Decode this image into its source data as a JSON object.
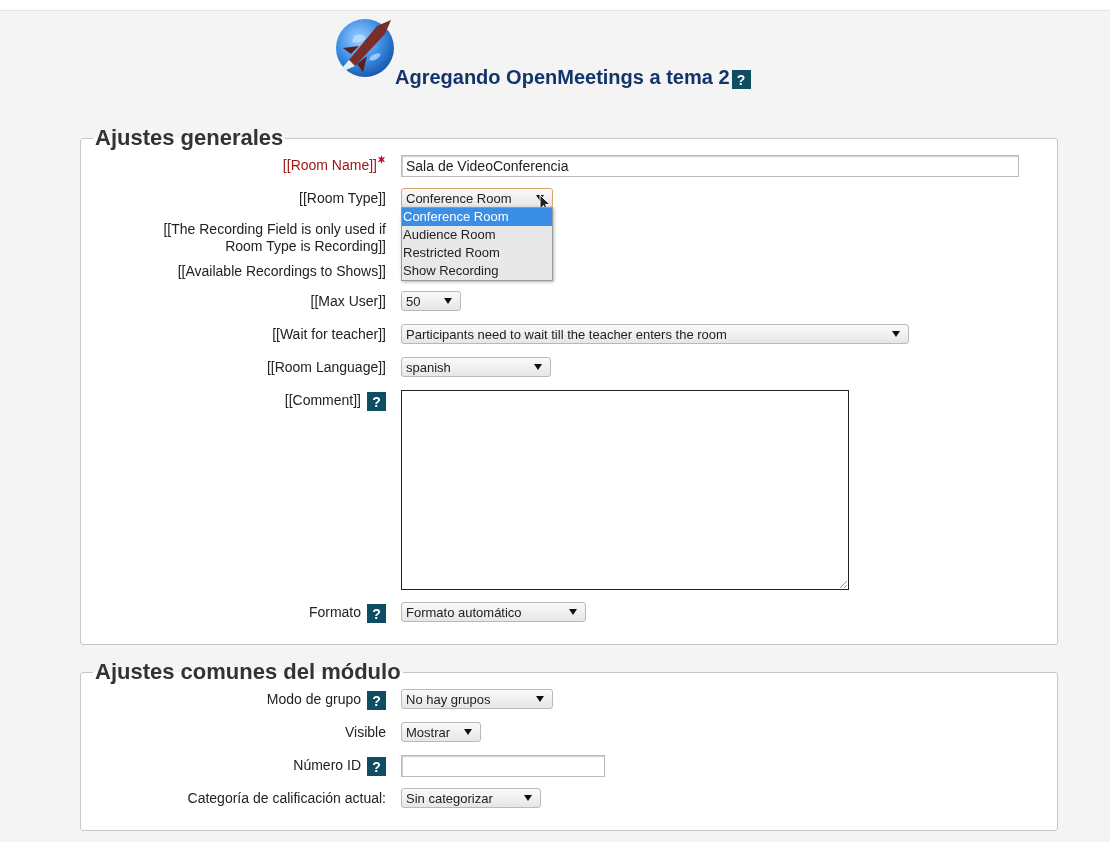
{
  "header": {
    "title": "Agregando OpenMeetings a tema 2",
    "help": "?"
  },
  "sections": [
    {
      "legend": "Ajustes generales",
      "rows": [
        {
          "kind": "text",
          "label": "[[Room Name]]",
          "required": true,
          "value": "Sala de VideoConferencia"
        },
        {
          "kind": "select",
          "label": "[[Room Type]]",
          "value": "Conference Room",
          "open": true,
          "options": [
            {
              "label": "Conference Room",
              "selected": true
            },
            {
              "label": "Audience Room",
              "selected": false
            },
            {
              "label": "Restricted Room",
              "selected": false
            },
            {
              "label": "Show Recording",
              "selected": false
            }
          ]
        },
        {
          "kind": "note",
          "label": "[[The Recording Field is only used if Room Type is Recording]]"
        },
        {
          "kind": "note",
          "label": "[[Available Recordings to Shows]]"
        },
        {
          "kind": "select",
          "label": "[[Max User]]",
          "value": "50"
        },
        {
          "kind": "select",
          "label": "[[Wait for teacher]]",
          "value": "Participants need to wait till the teacher enters the room"
        },
        {
          "kind": "select",
          "label": "[[Room Language]]",
          "value": "spanish"
        },
        {
          "kind": "textarea",
          "label": "[[Comment]]",
          "help": "?"
        },
        {
          "kind": "select",
          "label": "Formato",
          "help": "?",
          "value": "Formato automático"
        }
      ]
    },
    {
      "legend": "Ajustes comunes del módulo",
      "rows": [
        {
          "kind": "select",
          "label": "Modo de grupo",
          "help": "?",
          "value": "No hay grupos"
        },
        {
          "kind": "select",
          "label": "Visible",
          "value": "Mostrar"
        },
        {
          "kind": "text",
          "label": "Número ID",
          "help": "?"
        },
        {
          "kind": "select",
          "label": "Categoría de calificación actual:",
          "value": "Sin categorizar"
        }
      ]
    }
  ]
}
